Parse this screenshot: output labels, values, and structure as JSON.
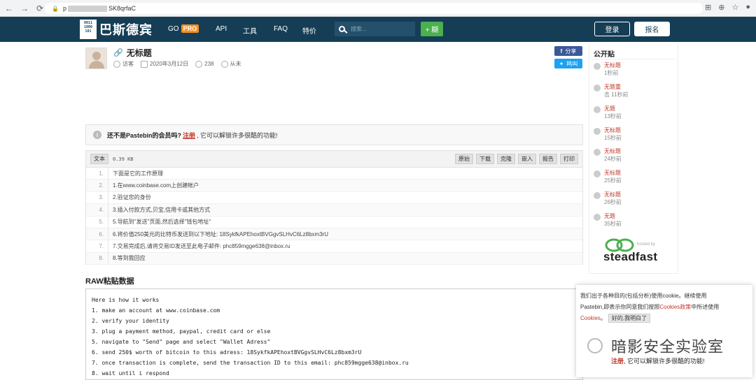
{
  "browser": {
    "url_prefix": "p",
    "url_suffix": "SK8qrfaC",
    "back_icon": "arrow-left-icon",
    "forward_icon": "arrow-right-icon",
    "reload_icon": "reload-icon",
    "lock_icon": "lock-icon"
  },
  "header": {
    "logo_text": "巴斯德宾",
    "logo_box": "0011\n1000\n101",
    "nav": {
      "go": "GO",
      "pro": "PRO",
      "api": "API",
      "tools": "工具",
      "faq": "FAQ",
      "deals": "特价"
    },
    "search_placeholder": "搜索...",
    "new_paste": "+ 糊",
    "login": "登录",
    "register": "报名",
    "colors": {
      "bar": "#153e56",
      "pro": "#f78f1e",
      "new": "#4caf50"
    }
  },
  "paste": {
    "title": "无标题",
    "author": "访客",
    "date": "2020年3月12日",
    "views": "238",
    "expires": "从未",
    "share_facebook": "分享",
    "share_twitter": "鸣叫"
  },
  "notice": {
    "question": "还不是Pastebin的会员吗?",
    "link": "注册",
    "rest": ", 它可以解锁许多很酷的功能!"
  },
  "code": {
    "syntax": "文本",
    "size": "0.39 KB",
    "buttons": [
      "原始",
      "下载",
      "克隆",
      "嵌入",
      "报告",
      "打印"
    ],
    "lines": [
      "下面是它的工作原理",
      "1.在www.coinbase.com上创建帐户",
      "2.验证您的身份",
      "3.插入付款方式,贝宝,信用卡或其他方式",
      "5.导航到\"发送\"页面,然后选择\"钱包地址\"",
      "6.将价值250美元的比特币发送到以下地址: 18SykfkAPEhoxtBVGgvSLHvC6Lz8bxm3rU",
      "7.交易完成后,请将交易ID发送至此电子邮件: phc859mgge638@inbox.ru",
      "8.等到我回应"
    ]
  },
  "raw": {
    "title": "RAW粘贴数据",
    "lines": [
      "Here is how it works",
      "1. make an account at www.coinbase.com",
      "2. verify your identity",
      "3. plug a payment method, paypal, credit card or else",
      "5. navigate to \"Send\" page and select \"Wallet Adress\"",
      "6. send 250$ worth of bitcoin to this adress: 18SykfkAPEhoxtBVGgvSLHvC6Lz8bxm3rU",
      "7. once transaction is complete, send the transaction ID to this email: phc859mgge638@inbox.ru",
      "8. wait until i respond"
    ]
  },
  "sidebar": {
    "title": "公开贴",
    "items": [
      {
        "title": "无标题",
        "sub": "1秒前"
      },
      {
        "title": "无题重",
        "sub": "击 11秒前"
      },
      {
        "title": "无题",
        "sub": "13秒前"
      },
      {
        "title": "无标题",
        "sub": "15秒前"
      },
      {
        "title": "无标题",
        "sub": "24秒前"
      },
      {
        "title": "无标题",
        "sub": "25秒前"
      },
      {
        "title": "无标题",
        "sub": "26秒前"
      },
      {
        "title": "无题",
        "sub": "35秒前"
      }
    ],
    "sponsor_hosted": "hosted by",
    "sponsor_name": "steadfast"
  },
  "cookie": {
    "line1": "我们出于各种目的(包括分析)使用cookie。继续使用",
    "line2a": "Pastebin,即表示你同意我们按照",
    "line2_link": "Cookies政策",
    "line2b": "中所述使用",
    "line3_link": "Cookies",
    "line3b": "。",
    "ok": "好的,我明白了"
  },
  "watermark": {
    "text": "暗影安全实验室",
    "overlay_link": "注册",
    "overlay_rest": ", 它可以解锁许多很酷的功能!"
  }
}
